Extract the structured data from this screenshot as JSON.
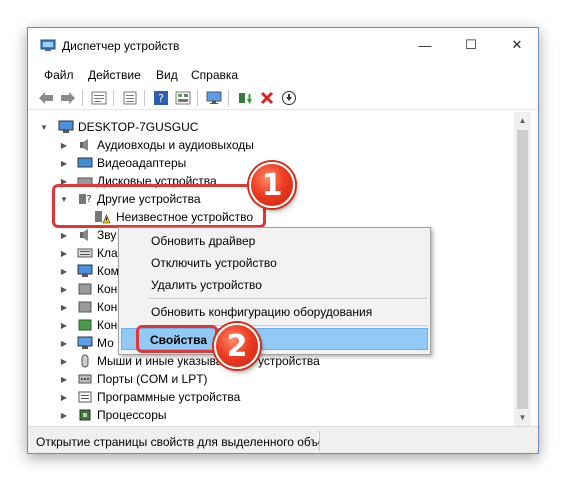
{
  "window": {
    "title": "Диспетчер устройств",
    "minimize_glyph": "—",
    "maximize_glyph": "☐",
    "close_glyph": "✕"
  },
  "menu": [
    "Файл",
    "Действие",
    "Вид",
    "Справка"
  ],
  "toolbar_icons": [
    "back-arrow-icon",
    "forward-arrow-icon",
    "show-hidden-icon",
    "properties-icon",
    "help-icon",
    "view-icon",
    "monitor-icon",
    "update-driver-icon",
    "uninstall-icon",
    "download-icon"
  ],
  "tree": {
    "root": "DESKTOP-7GUSGUC",
    "items": [
      {
        "label": "Аудиовходы и аудиовыходы",
        "icon": "speaker-icon"
      },
      {
        "label": "Видеоадаптеры",
        "icon": "display-adapter-icon"
      },
      {
        "label": "Дисковые устройства",
        "icon": "disk-icon"
      },
      {
        "label": "Другие устройства",
        "icon": "unknown-device-icon",
        "expanded": true
      },
      {
        "label": "Неизвестное устройство",
        "icon": "warning-device-icon",
        "child": true
      },
      {
        "label": "Зву",
        "icon": "sound-icon"
      },
      {
        "label": "Кла",
        "icon": "keyboard-icon"
      },
      {
        "label": "Ком",
        "icon": "computer-icon"
      },
      {
        "label": "Кон",
        "icon": "controller-icon"
      },
      {
        "label": "Кон",
        "icon": "controller-icon"
      },
      {
        "label": "Кон",
        "icon": "network-controller-icon"
      },
      {
        "label": "Мо",
        "icon": "monitor-icon"
      },
      {
        "label": "Мыши и иные указывающие устройства",
        "icon": "mouse-icon"
      },
      {
        "label": "Порты (COM и LPT)",
        "icon": "port-icon"
      },
      {
        "label": "Программные устройства",
        "icon": "software-device-icon"
      },
      {
        "label": "Процессоры",
        "icon": "cpu-icon"
      }
    ]
  },
  "context_menu": {
    "update_driver": "Обновить драйвер",
    "disable_device": "Отключить устройство",
    "uninstall_device": "Удалить устройство",
    "scan_hardware": "Обновить конфигурацию оборудования",
    "properties": "Свойства"
  },
  "badges": {
    "one": "1",
    "two": "2"
  },
  "statusbar": {
    "text": "Открытие страницы свойств для выделенного объекта."
  },
  "colors": {
    "highlight": "#91c9f7",
    "callout": "#e03838",
    "badge": "#ee3d23"
  }
}
